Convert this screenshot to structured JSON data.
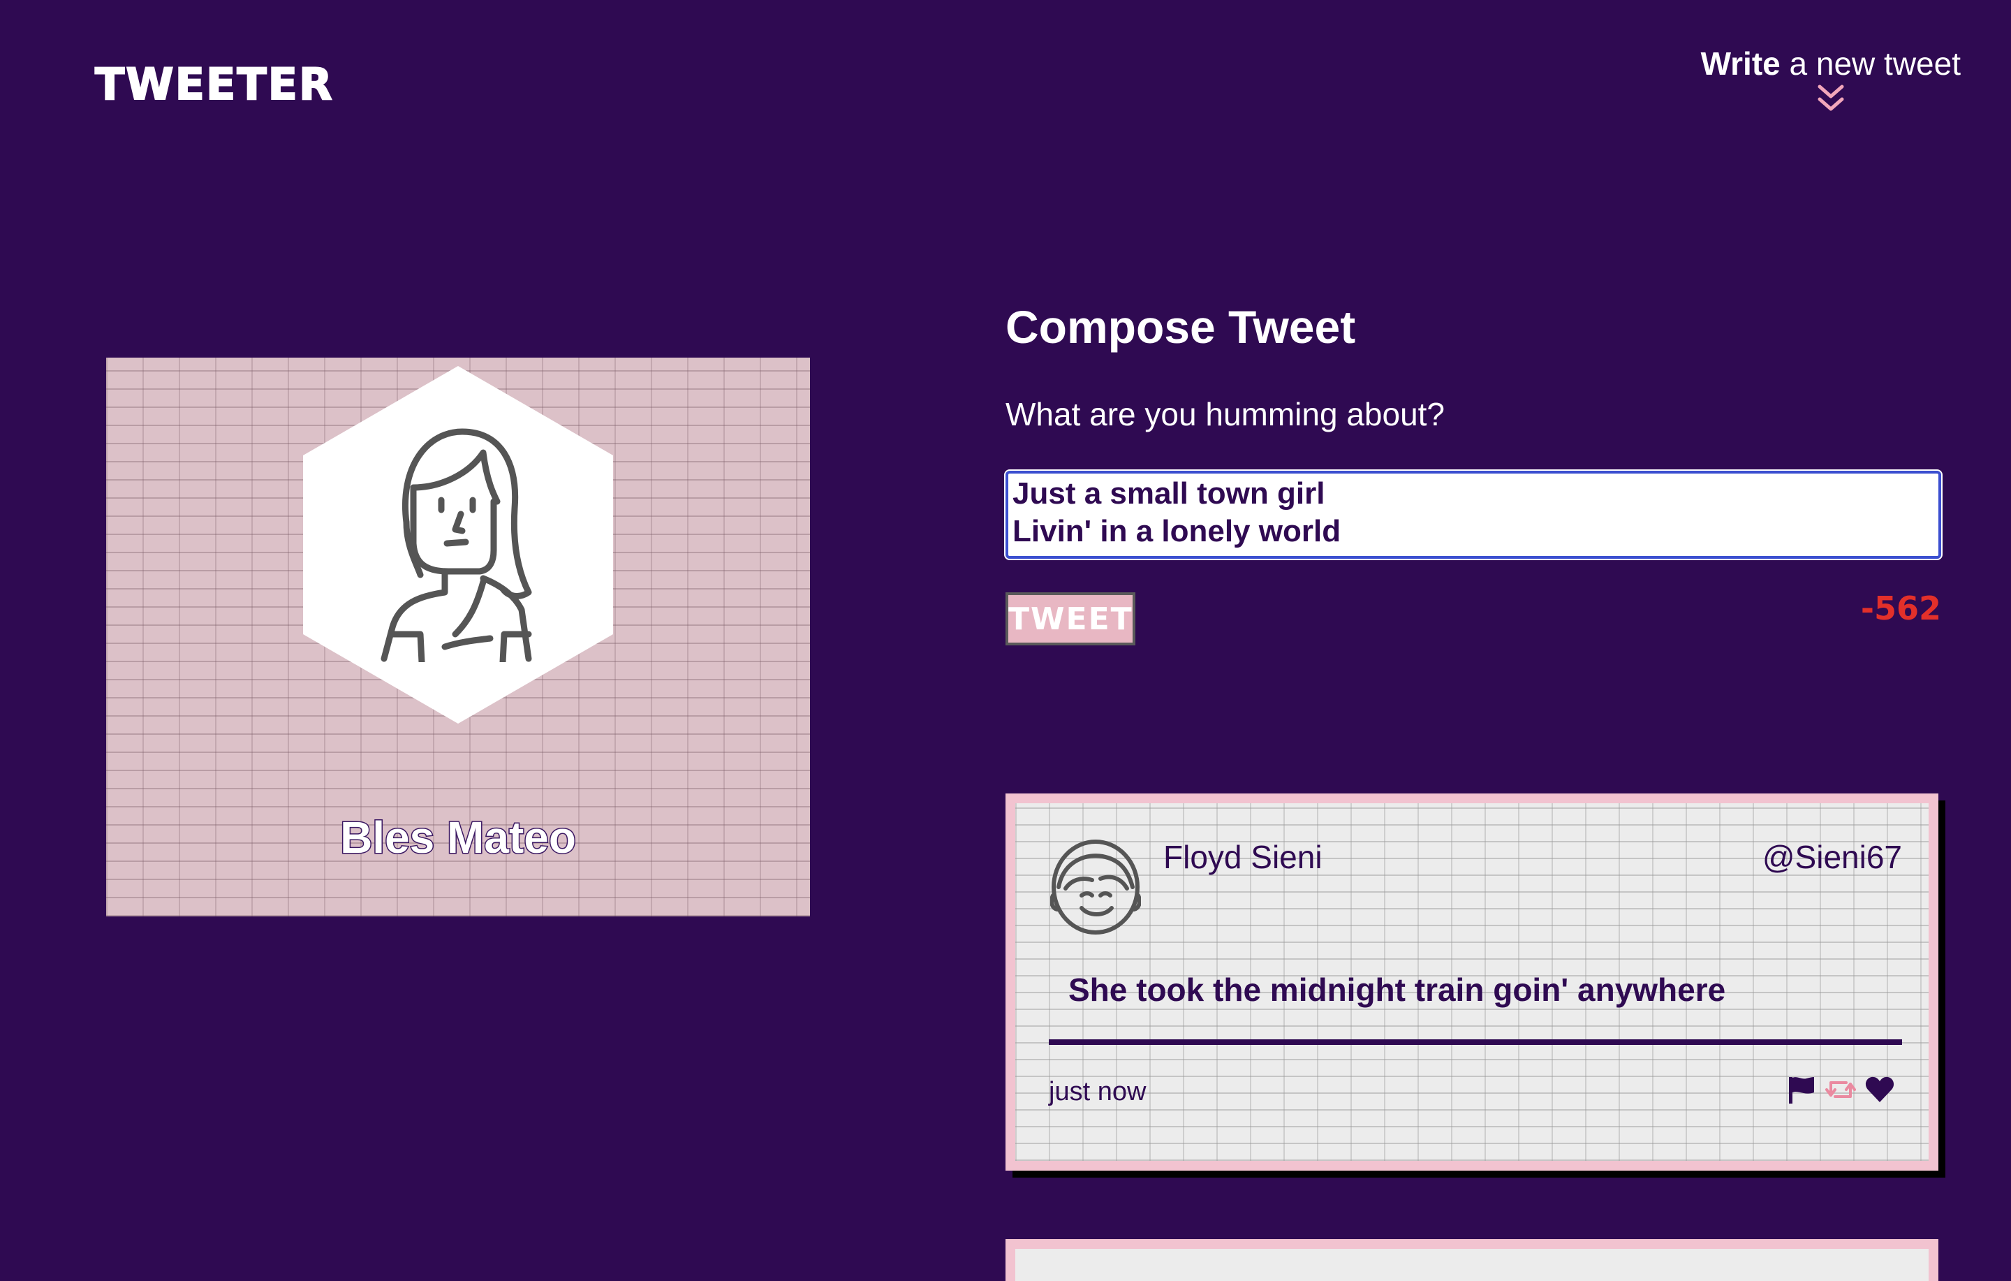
{
  "nav": {
    "brand": "TWEETER",
    "write_bold": "Write",
    "write_rest": " a new tweet",
    "chevron_icon": "double-chevron-down-icon"
  },
  "profile": {
    "name": "Bles Mateo",
    "avatar_icon": "woman-avatar-icon"
  },
  "compose": {
    "title": "Compose Tweet",
    "subtitle": "What are you humming about?",
    "textarea_value": "Just a small town girl\nLivin' in a lonely world",
    "button_label": "TWEET",
    "counter": "-562"
  },
  "tweets": [
    {
      "user": "Floyd Sieni",
      "handle": "@Sieni67",
      "text": "She took the midnight train goin' anywhere",
      "time": "just now",
      "avatar_icon": "man-avatar-icon",
      "actions": [
        "flag-icon",
        "retweet-icon",
        "heart-icon"
      ]
    }
  ],
  "colors": {
    "background": "#2f0a52",
    "accent_pink": "#e8b7c3",
    "counter_red": "#e3302a",
    "text_dark": "#2f0a52"
  }
}
